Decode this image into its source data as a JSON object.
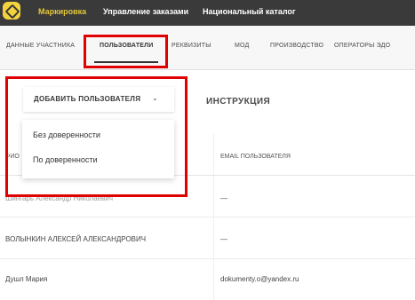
{
  "topnav": {
    "items": [
      {
        "label": "Маркировка",
        "active": true
      },
      {
        "label": "Управление заказами",
        "active": false
      },
      {
        "label": "Национальный каталог",
        "active": false
      }
    ]
  },
  "tabs": [
    {
      "label": "ДАННЫЕ УЧАСТНИКА",
      "active": false
    },
    {
      "label": "ПОЛЬЗОВАТЕЛИ",
      "active": true
    },
    {
      "label": "РЕКВИЗИТЫ",
      "active": false
    },
    {
      "label": "МОД",
      "active": false
    },
    {
      "label": "ПРОИЗВОДСТВО",
      "active": false
    },
    {
      "label": "ОПЕРАТОРЫ ЭДО",
      "active": false
    }
  ],
  "toolbar": {
    "add_user_label": "ДОБАВИТЬ ПОЛЬЗОВАТЕЛЯ",
    "instruction_label": "ИНСТРУКЦИЯ"
  },
  "dropdown": {
    "options": [
      "Без доверенности",
      "По доверенности"
    ]
  },
  "table": {
    "columns": [
      "ФИО",
      "EMAIL ПОЛЬЗОВАТЕЛЯ"
    ],
    "rows": [
      {
        "name": "Шингарь Александр Николаевич",
        "email": "—"
      },
      {
        "name": "ВОЛЫНКИН АЛЕКСЕЙ АЛЕКСАНДРОВИЧ",
        "email": "—"
      },
      {
        "name": "Душл Мария",
        "email": "dokumenty.o@yandex.ru"
      }
    ]
  },
  "colors": {
    "topbar": "#3a3a3a",
    "accent": "#e3c83a",
    "highlight": "#e00000"
  },
  "icons": {
    "logo": "brand-logo-icon",
    "dropdown": "chevron-down-icon"
  }
}
